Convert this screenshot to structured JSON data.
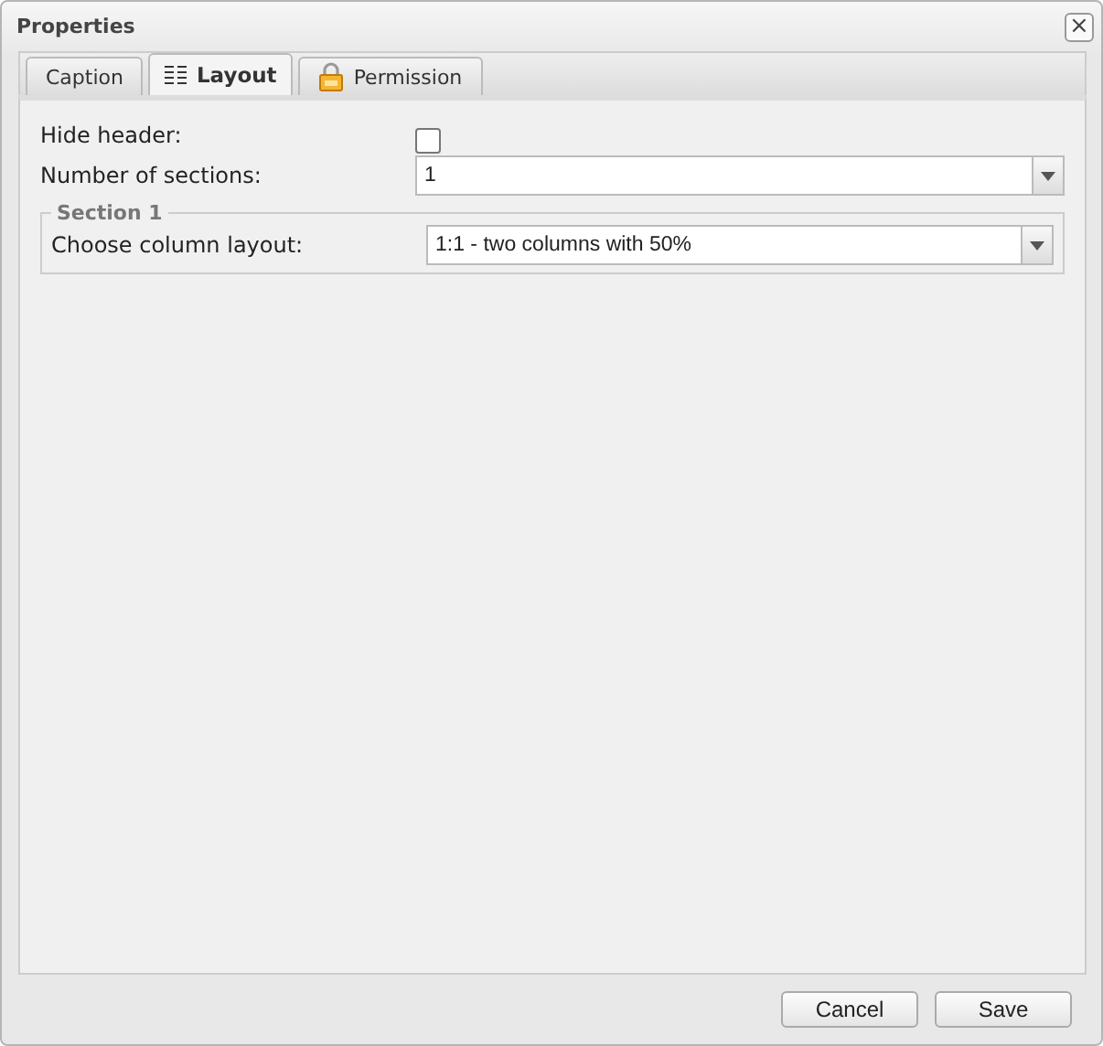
{
  "window": {
    "title": "Properties",
    "close": "×"
  },
  "tabs": [
    {
      "label": "Caption",
      "kind": "plain",
      "selected": false
    },
    {
      "label": "Layout",
      "kind": "lines",
      "selected": true
    },
    {
      "label": "Permission",
      "kind": "lock",
      "selected": false
    }
  ],
  "fields": [
    {
      "kind": "checkbox",
      "label": "Hide header:",
      "checked": false
    },
    {
      "kind": "select",
      "label": "Number of sections:",
      "value": "1"
    }
  ],
  "sections": [
    {
      "legend": "Section 1",
      "fields": [
        {
          "kind": "select",
          "label": "Choose column layout:",
          "value": "1:1 - two columns with 50%"
        }
      ]
    }
  ],
  "buttons": [
    "Cancel",
    "Save"
  ]
}
